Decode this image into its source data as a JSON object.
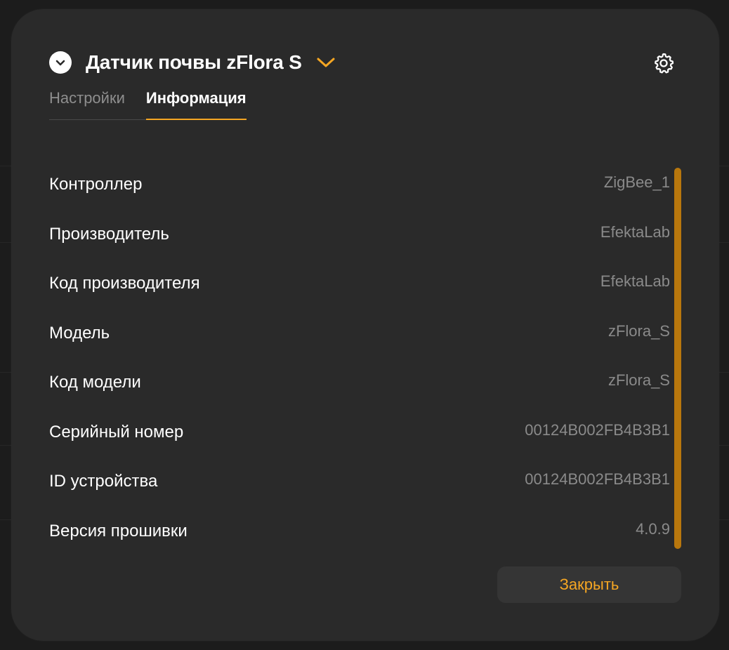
{
  "header": {
    "title": "Датчик почвы zFlora S"
  },
  "tabs": [
    {
      "label": "Настройки",
      "active": false
    },
    {
      "label": "Информация",
      "active": true
    }
  ],
  "info": [
    {
      "label": "Контроллер",
      "value": "ZigBee_1"
    },
    {
      "label": "Производитель",
      "value": "EfektaLab"
    },
    {
      "label": "Код производителя",
      "value": "EfektaLab"
    },
    {
      "label": "Модель",
      "value": "zFlora_S"
    },
    {
      "label": "Код модели",
      "value": "zFlora_S"
    },
    {
      "label": "Серийный номер",
      "value": "00124B002FB4B3B1"
    },
    {
      "label": "ID устройства",
      "value": "00124B002FB4B3B1"
    },
    {
      "label": "Версия прошивки",
      "value": "4.0.9"
    }
  ],
  "footer": {
    "close_label": "Закрыть"
  },
  "colors": {
    "accent": "#f5a623",
    "modal_bg": "#2a2a2a",
    "scrollbar": "#b8770d"
  },
  "icons": {
    "collapse": "chevron-down-circle-icon",
    "dropdown": "chevron-down-icon",
    "settings": "gear-icon"
  }
}
